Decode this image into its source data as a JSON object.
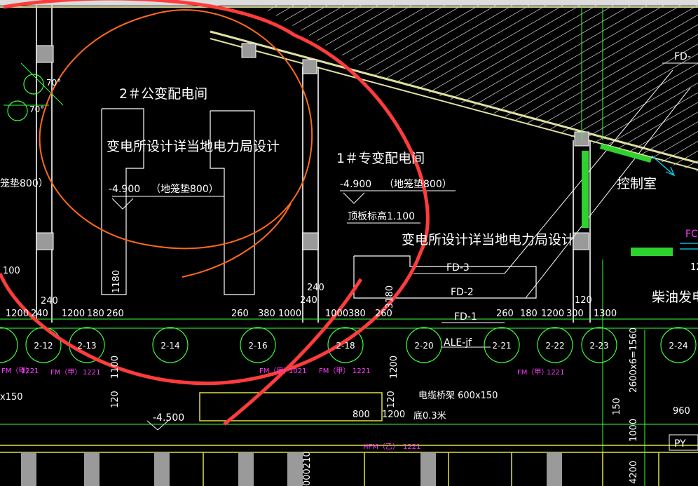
{
  "rooms": {
    "public_substation": "2＃公变配电间",
    "private_substation": "1＃专变配电间",
    "control_room": "控制室",
    "diesel_room": "柴油发电机",
    "note_left": "变电所设计详当地电力局设计",
    "note_right": "变电所设计详当地电力局设计"
  },
  "levels": {
    "left_level": "-4.900",
    "left_pad": "（地笼垫800）",
    "right_level": "-4.900",
    "right_pad": "（地笼垫800）",
    "edge_pad": "笼垫800）",
    "roof_level": "顶板标高1.100",
    "corridor_level": "-4.500"
  },
  "equipment_labels": {
    "fd3": "FD-3",
    "fd2": "FD-2",
    "fd1": "FD-1",
    "ale": "ALE-jf",
    "fd_top": "FD-",
    "fc": "FC"
  },
  "cable": {
    "tray": "电缆桥架 600x150",
    "height": "底0.3米"
  },
  "axes": [
    "2-12",
    "2-13",
    "2-14",
    "2-16",
    "2-18",
    "2-20",
    "2-21",
    "2-22",
    "2-23",
    "2-24"
  ],
  "dimensions": {
    "top_row_left": [
      "1200",
      "240",
      "1200",
      "180",
      "260"
    ],
    "top_row_mid": [
      "260",
      "380",
      "1000",
      "240",
      "1000",
      "380",
      "260"
    ],
    "top_row_right": [
      "260",
      "180",
      "1200",
      "300",
      "1300"
    ],
    "misc": [
      "240",
      "240",
      "1180",
      "3180",
      "100",
      "1100",
      "x150",
      "1000",
      "1200",
      "120",
      "800",
      "1200",
      "150",
      "960",
      "120",
      "12",
      "2600x6=1560",
      "1000",
      "4200",
      "000210",
      "120"
    ]
  },
  "doors": [
    "FM（甲）",
    "1221",
    "FM（甲）",
    "1221",
    "FM（甲）",
    "1021",
    "FM（甲）",
    "1221",
    "FM（甲）",
    "1221",
    "FM（甲）",
    "1021",
    "HFM（乙）",
    "1221"
  ],
  "angles": [
    "70°",
    "70°"
  ],
  "stair": "PY"
}
